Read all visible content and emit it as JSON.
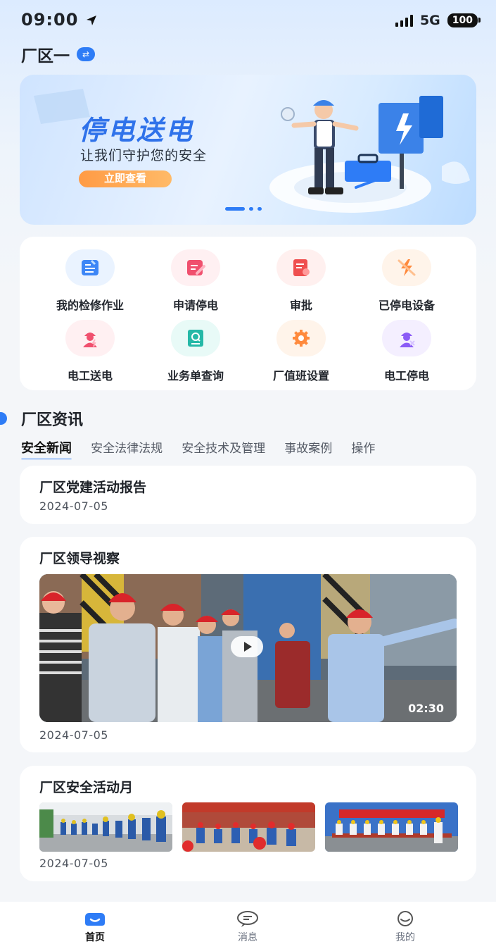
{
  "status_bar": {
    "time": "09:00",
    "network": "5G",
    "battery": "100"
  },
  "header": {
    "factory_name": "厂区一"
  },
  "banner": {
    "title": "停电送电",
    "subtitle": "让我们守护您的安全",
    "button_label": "立即查看",
    "page_count": 3,
    "active_page": 1
  },
  "actions": [
    {
      "label": "我的检修作业",
      "icon": "repair-task-icon",
      "color": "#3d86f6",
      "bg": "#eaf3ff"
    },
    {
      "label": "申请停电",
      "icon": "apply-edit-icon",
      "color": "#f0506e",
      "bg": "#fff0f2"
    },
    {
      "label": "审批",
      "icon": "approval-icon",
      "color": "#ef4f4f",
      "bg": "#fff0ef"
    },
    {
      "label": "已停电设备",
      "icon": "power-off-device-icon",
      "color": "#ff8a3d",
      "bg": "#fff4ea"
    },
    {
      "label": "电工送电",
      "icon": "electrician-power-on-icon",
      "color": "#f0506e",
      "bg": "#fff0f2"
    },
    {
      "label": "业务单查询",
      "icon": "order-search-icon",
      "color": "#25b8a7",
      "bg": "#e8faf7"
    },
    {
      "label": "厂值班设置",
      "icon": "duty-settings-icon",
      "color": "#ff8a3d",
      "bg": "#fff4ea"
    },
    {
      "label": "电工停电",
      "icon": "electrician-power-off-icon",
      "color": "#8b5cf6",
      "bg": "#f4efff"
    }
  ],
  "news_section": {
    "title": "厂区资讯",
    "tabs": [
      "安全新闻",
      "安全法律法规",
      "安全技术及管理",
      "事故案例",
      "操作"
    ],
    "active_tab": 0
  },
  "news": [
    {
      "title": "厂区党建活动报告",
      "date": "2024-07-05"
    },
    {
      "title": "厂区领导视察",
      "date": "2024-07-05",
      "video_duration": "02:30"
    },
    {
      "title": "厂区安全活动月",
      "date": "2024-07-05"
    }
  ],
  "tabbar": [
    {
      "label": "首页",
      "icon": "home-icon",
      "active": true
    },
    {
      "label": "消息",
      "icon": "message-icon",
      "active": false
    },
    {
      "label": "我的",
      "icon": "profile-icon",
      "active": false
    }
  ],
  "colors": {
    "primary": "#2e7cf6",
    "accent_orange": "#ff9b45",
    "page_bg": "#f4f6f9"
  }
}
